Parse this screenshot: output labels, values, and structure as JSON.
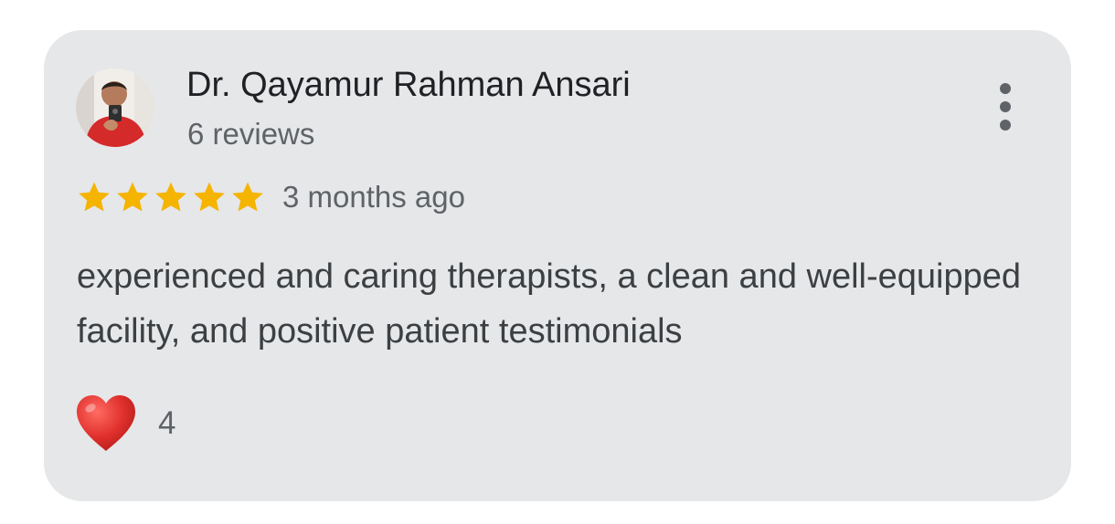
{
  "review": {
    "reviewer_name": "Dr. Qayamur Rahman Ansari",
    "review_count": "6 reviews",
    "rating": 5,
    "time_ago": "3 months ago",
    "text": "experienced and caring therapists, a clean and well-equipped facility, and positive patient testimonials",
    "likes": "4"
  },
  "icons": {
    "avatar": "avatar-photo",
    "star": "star-icon",
    "more": "more-vertical-icon",
    "like": "heart-icon"
  },
  "colors": {
    "card_background": "#e6e7e9",
    "star": "#f5b400",
    "heart": "#e0302c",
    "name_text": "#202124",
    "secondary_text": "#5f6368"
  }
}
